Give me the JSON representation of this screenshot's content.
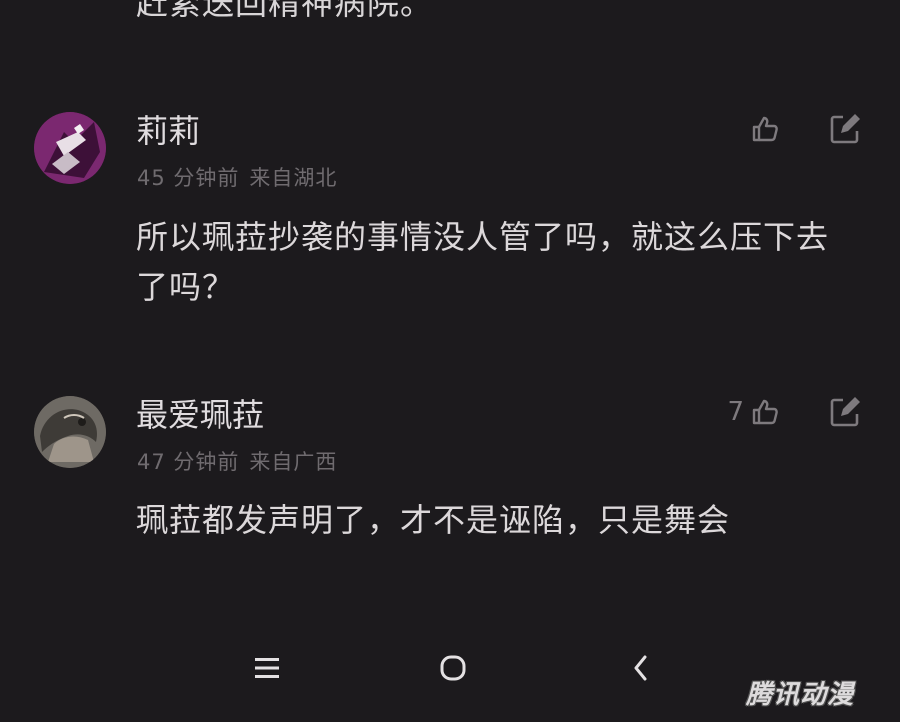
{
  "clipped_text": "赶紧送回精神病院。",
  "comments": [
    {
      "username": "莉莉",
      "time": "45 分钟前",
      "location": "来自湖北",
      "text": "所以珮菈抄袭的事情没人管了吗，就这么压下去了吗？",
      "like_count": ""
    },
    {
      "username": "最爱珮菈",
      "time": "47 分钟前",
      "location": "来自广西",
      "text": "珮菈都发声明了，才不是诬陷，只是舞会",
      "like_count": "7"
    }
  ],
  "icons": {
    "like": "thumbs-up-icon",
    "reply": "reply-icon",
    "menu": "menu-icon",
    "home": "home-icon",
    "back": "back-icon"
  },
  "watermark": "腾讯动漫",
  "colors": {
    "background": "#1c1a1d",
    "text": "#dcd8da",
    "meta": "#6f6b6f"
  }
}
